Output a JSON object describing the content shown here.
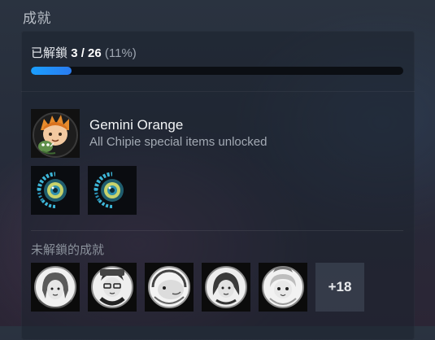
{
  "section": {
    "title": "成就"
  },
  "progress": {
    "prefix": "已解鎖",
    "count": "3 / 26",
    "percent_text": "(11%)",
    "fraction": 0.11,
    "accent": "#1a9fff"
  },
  "featured": {
    "name": "Gemini Orange",
    "description": "All Chipie special items unlocked",
    "icon": "gemini-orange-avatar-icon"
  },
  "unlocked_more": [
    {
      "icon": "blue-eye-achievement-icon"
    },
    {
      "icon": "blue-eye-achievement-icon"
    }
  ],
  "locked": {
    "title": "未解鎖的成就",
    "items": [
      {
        "icon": "locked-portrait-1-icon"
      },
      {
        "icon": "locked-portrait-2-icon"
      },
      {
        "icon": "locked-portrait-3-icon"
      },
      {
        "icon": "locked-portrait-4-icon"
      },
      {
        "icon": "locked-portrait-5-icon"
      }
    ],
    "more_label": "+18"
  }
}
